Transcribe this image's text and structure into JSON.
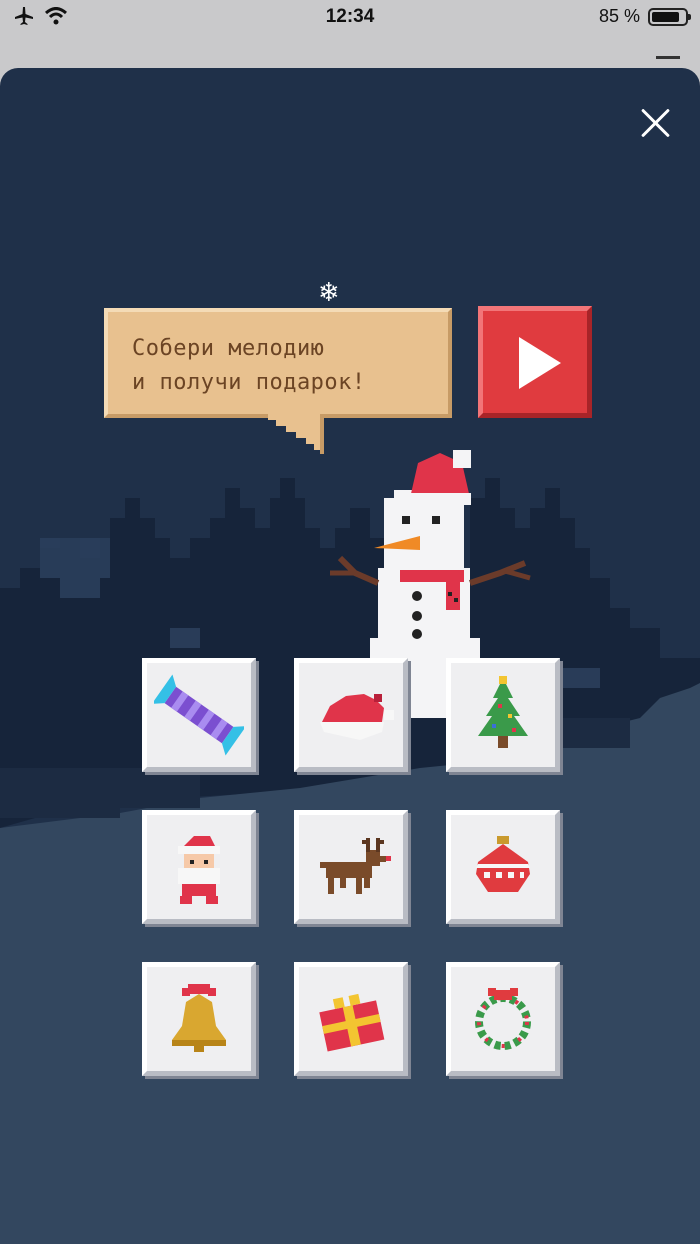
{
  "status_bar": {
    "time": "12:34",
    "battery_label": "85 %",
    "battery_level": 0.85
  },
  "modal": {
    "bubble_line1": "Собери мелодию",
    "bubble_line2": "и получи подарок!",
    "close_icon": "close-icon",
    "play_icon": "play-icon"
  },
  "tiles": [
    {
      "icon": "candy-icon"
    },
    {
      "icon": "santa-hat-icon"
    },
    {
      "icon": "christmas-tree-icon"
    },
    {
      "icon": "santa-icon"
    },
    {
      "icon": "reindeer-icon"
    },
    {
      "icon": "ornament-icon"
    },
    {
      "icon": "bell-icon"
    },
    {
      "icon": "gift-icon"
    },
    {
      "icon": "wreath-icon"
    }
  ],
  "colors": {
    "modal_bg": "#1f3049",
    "play_button": "#e03b3f",
    "bubble": "#e8c18f",
    "bubble_text": "#6b4424"
  }
}
